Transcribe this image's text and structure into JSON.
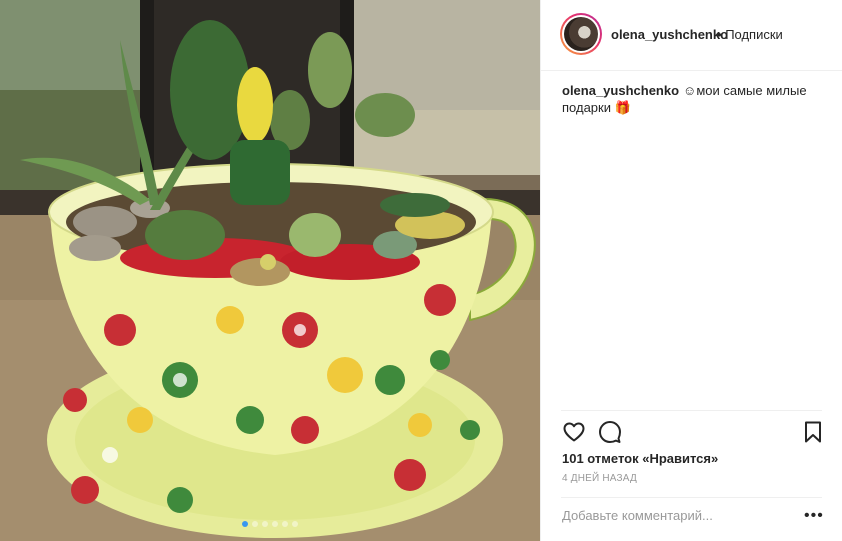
{
  "post": {
    "username": "olena_yushchenko",
    "follow_separator": "•",
    "follow_label": "Подписки",
    "caption_username": "olena_yushchenko",
    "caption_text": "☺мои самые милые подарки 🎁",
    "likes": "101 отметок «Нравится»",
    "time": "4 ДНЕЙ НАЗАД",
    "comment_placeholder": "Добавьте комментарий...",
    "more_label": "•••"
  },
  "carousel": {
    "slides": 6,
    "active_index": 0
  },
  "icons": {
    "like": "heart-icon",
    "comment": "comment-icon",
    "save": "bookmark-icon",
    "more": "more-options-icon"
  },
  "colors": {
    "accent": "#3897f0",
    "text": "#262626",
    "muted": "#999999",
    "divider": "#efefef"
  }
}
